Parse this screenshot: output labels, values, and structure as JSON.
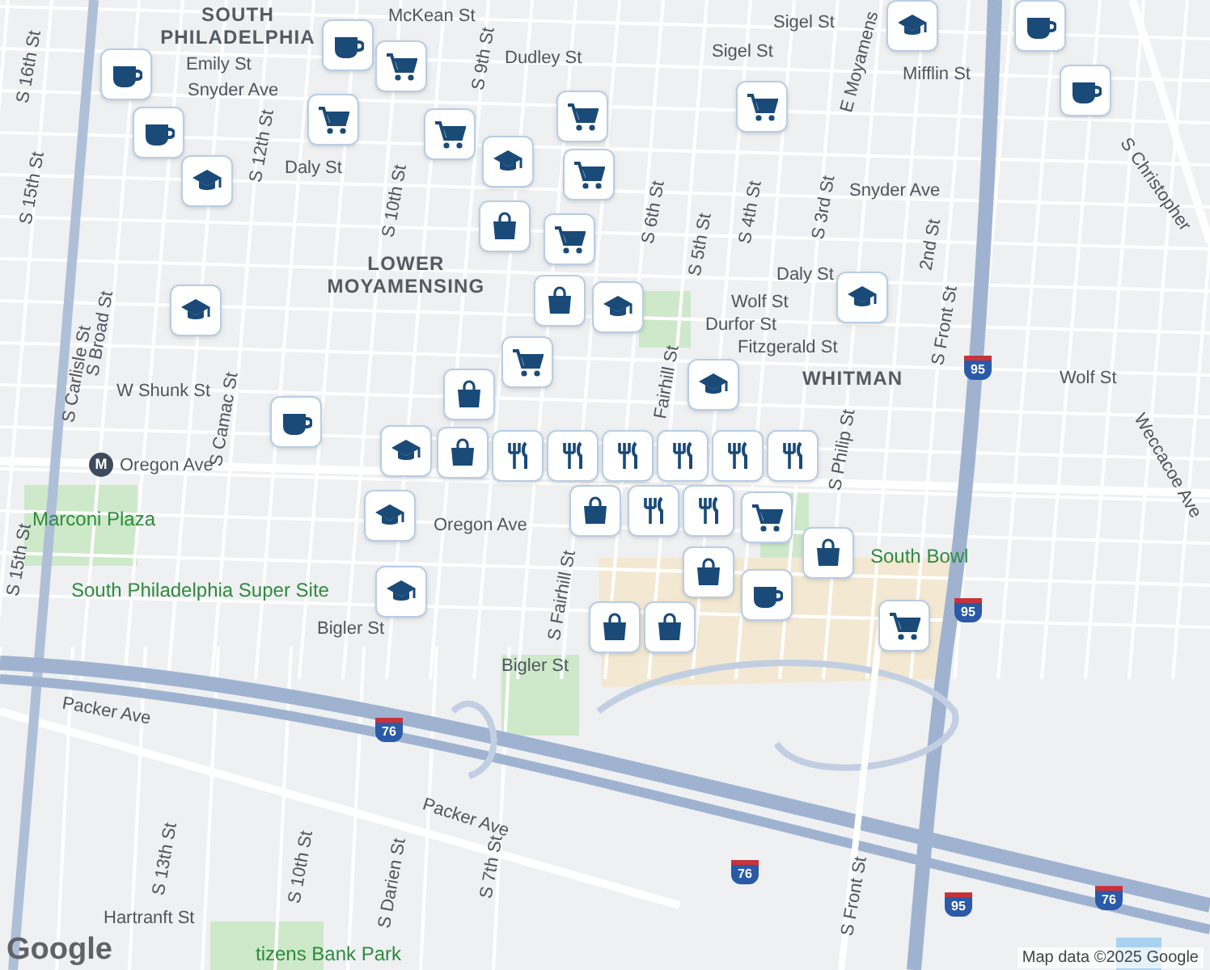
{
  "map": {
    "areas": [
      {
        "text": "SOUTH PHILADELPHIA",
        "kind": "district"
      },
      {
        "text": "LOWER MOYAMENSING",
        "kind": "district"
      },
      {
        "text": "WHITMAN",
        "kind": "district"
      },
      {
        "text": "Marconi Plaza",
        "kind": "park"
      },
      {
        "text": "South Philadelphia Super Site",
        "kind": "park"
      },
      {
        "text": "South Bowl",
        "kind": "park"
      },
      {
        "text": "tizens Bank Park",
        "kind": "park"
      }
    ],
    "streets": [
      {
        "text": "Sigel St"
      },
      {
        "text": "Sigel St"
      },
      {
        "text": "Mifflin St"
      },
      {
        "text": "McKean St"
      },
      {
        "text": "Emily St"
      },
      {
        "text": "Dudley St"
      },
      {
        "text": "Snyder Ave"
      },
      {
        "text": "Snyder Ave"
      },
      {
        "text": "Daly St"
      },
      {
        "text": "Daly St"
      },
      {
        "text": "W Shunk St"
      },
      {
        "text": "Wolf St"
      },
      {
        "text": "Durfor St"
      },
      {
        "text": "Fitzgerald St"
      },
      {
        "text": "Wolf St"
      },
      {
        "text": "Oregon Ave"
      },
      {
        "text": "Oregon Ave"
      },
      {
        "text": "S Broad St"
      },
      {
        "text": "S 15th St"
      },
      {
        "text": "S 16th St"
      },
      {
        "text": "S Carlisle St"
      },
      {
        "text": "S Camac St"
      },
      {
        "text": "S 10th St"
      },
      {
        "text": "S 9th St"
      },
      {
        "text": "S 12th St"
      },
      {
        "text": "S 6th St"
      },
      {
        "text": "S 5th St"
      },
      {
        "text": "S 4th St"
      },
      {
        "text": "S 3rd St"
      },
      {
        "text": "2nd St"
      },
      {
        "text": "S Front St"
      },
      {
        "text": "S Philip St"
      },
      {
        "text": "Fairhill St"
      },
      {
        "text": "S Fairhill St"
      },
      {
        "text": "Bigler St"
      },
      {
        "text": "Bigler St"
      },
      {
        "text": "Packer Ave"
      },
      {
        "text": "Packer Ave"
      },
      {
        "text": "S 13th St"
      },
      {
        "text": "S 10th St"
      },
      {
        "text": "S Darien St"
      },
      {
        "text": "S 7th St"
      },
      {
        "text": "Hartranft St"
      },
      {
        "text": "S Front St"
      },
      {
        "text": "S Christopher"
      },
      {
        "text": "Weccacoe Ave"
      },
      {
        "text": "E Moyamens"
      },
      {
        "text": "S 15th St"
      }
    ],
    "shields": [
      {
        "text": "76",
        "kind": "interstate"
      },
      {
        "text": "76",
        "kind": "interstate"
      },
      {
        "text": "76",
        "kind": "interstate"
      },
      {
        "text": "95",
        "kind": "interstate"
      },
      {
        "text": "95",
        "kind": "interstate"
      },
      {
        "text": "95",
        "kind": "interstate"
      },
      {
        "text": "M",
        "kind": "metro"
      }
    ],
    "markers": [
      {
        "kind": "coffee"
      },
      {
        "kind": "coffee"
      },
      {
        "kind": "coffee"
      },
      {
        "kind": "coffee"
      },
      {
        "kind": "coffee"
      },
      {
        "kind": "coffee"
      },
      {
        "kind": "coffee"
      },
      {
        "kind": "cart"
      },
      {
        "kind": "cart"
      },
      {
        "kind": "cart"
      },
      {
        "kind": "cart"
      },
      {
        "kind": "cart"
      },
      {
        "kind": "cart"
      },
      {
        "kind": "cart"
      },
      {
        "kind": "cart"
      },
      {
        "kind": "cart"
      },
      {
        "kind": "cart"
      },
      {
        "kind": "school"
      },
      {
        "kind": "school"
      },
      {
        "kind": "school"
      },
      {
        "kind": "school"
      },
      {
        "kind": "school"
      },
      {
        "kind": "school"
      },
      {
        "kind": "school"
      },
      {
        "kind": "school"
      },
      {
        "kind": "school"
      },
      {
        "kind": "school"
      },
      {
        "kind": "bag"
      },
      {
        "kind": "bag"
      },
      {
        "kind": "bag"
      },
      {
        "kind": "bag"
      },
      {
        "kind": "bag"
      },
      {
        "kind": "bag"
      },
      {
        "kind": "bag"
      },
      {
        "kind": "bag"
      },
      {
        "kind": "bag"
      },
      {
        "kind": "restaurant"
      },
      {
        "kind": "restaurant"
      },
      {
        "kind": "restaurant"
      },
      {
        "kind": "restaurant"
      },
      {
        "kind": "restaurant"
      },
      {
        "kind": "restaurant"
      },
      {
        "kind": "restaurant"
      },
      {
        "kind": "restaurant"
      }
    ]
  },
  "footer": {
    "logo": "Google",
    "attribution": "Map data ©2025 Google"
  }
}
